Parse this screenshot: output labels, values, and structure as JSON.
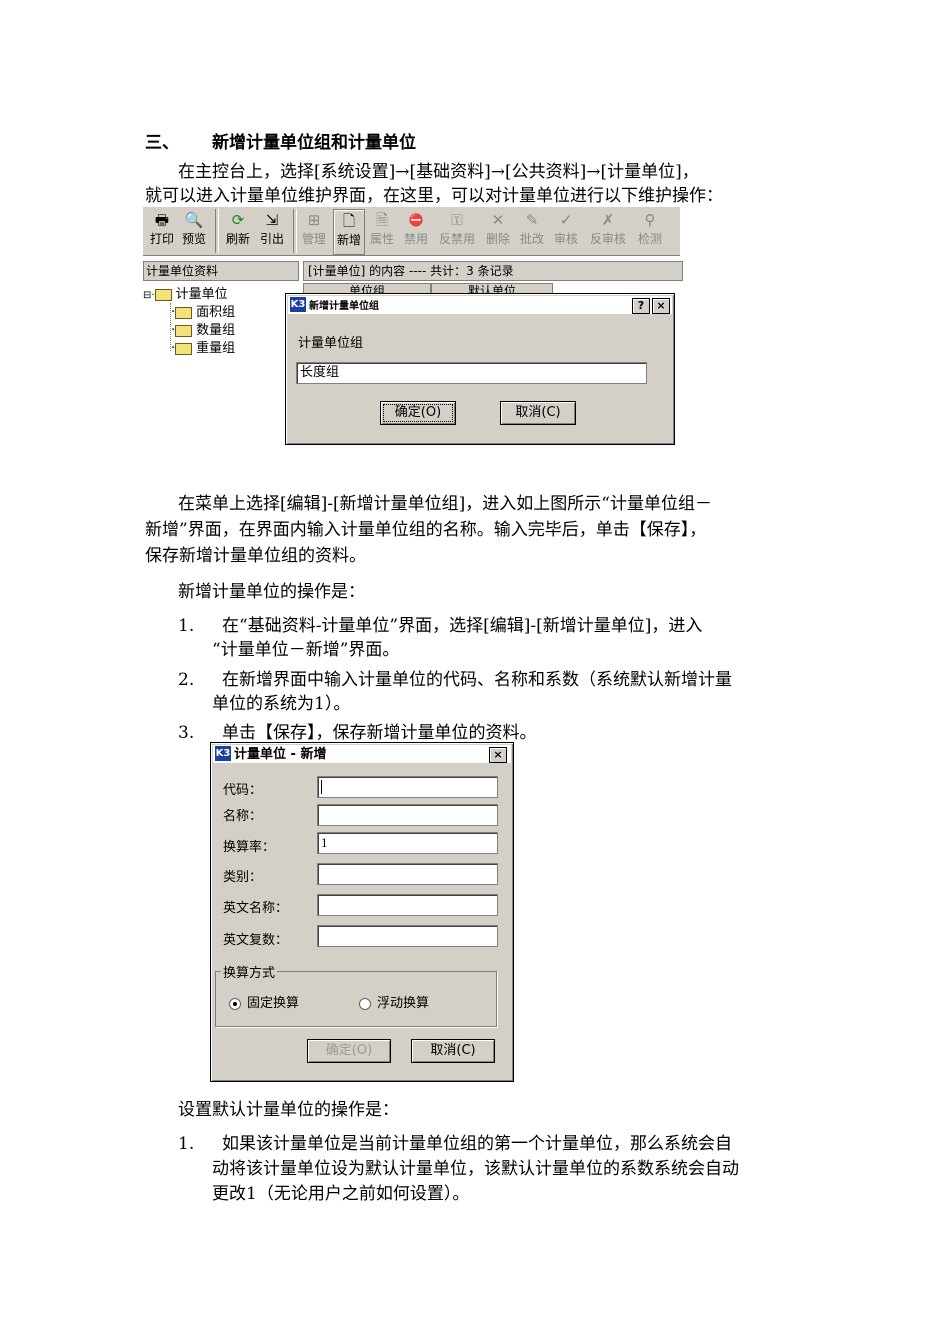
{
  "section": {
    "number": "三、",
    "title": "新增计量单位组和计量单位"
  },
  "intro": {
    "line1": "在主控台上，选择[系统设置]→[基础资料]→[公共资料]→[计量单位]，",
    "line2": "就可以进入计量单位维护界面，在这里，可以对计量单位进行以下维护操作："
  },
  "toolbar": {
    "buttons": [
      {
        "label": "打印",
        "icon": "printer-icon",
        "glyph": "🖶"
      },
      {
        "label": "预览",
        "icon": "preview-icon",
        "glyph": "🔍"
      },
      {
        "label": "刷新",
        "icon": "refresh-icon",
        "glyph": "⟳"
      },
      {
        "label": "引出",
        "icon": "export-icon",
        "glyph": "⇲"
      },
      {
        "label": "管理",
        "icon": "manage-icon",
        "glyph": "⊞"
      },
      {
        "label": "新增",
        "icon": "new-icon",
        "glyph": "🗋"
      },
      {
        "label": "属性",
        "icon": "properties-icon",
        "glyph": "🗎"
      },
      {
        "label": "禁用",
        "icon": "disable-icon",
        "glyph": "⛔"
      },
      {
        "label": "反禁用",
        "icon": "enable-icon",
        "glyph": "⚿"
      },
      {
        "label": "删除",
        "icon": "delete-icon",
        "glyph": "✕"
      },
      {
        "label": "批改",
        "icon": "batch-edit-icon",
        "glyph": "✎"
      },
      {
        "label": "审核",
        "icon": "approve-icon",
        "glyph": "✓"
      },
      {
        "label": "反审核",
        "icon": "unapprove-icon",
        "glyph": "✗"
      },
      {
        "label": "检测",
        "icon": "check-icon",
        "glyph": "⚲"
      }
    ]
  },
  "tree": {
    "header": "计量单位资料",
    "root": "计量单位",
    "children": [
      "面积组",
      "数量组",
      "重量组"
    ]
  },
  "list": {
    "header": "[计量单位] 的内容 ---- 共计：3 条记录",
    "columns": [
      "单位组",
      "默认单位"
    ]
  },
  "group_dialog": {
    "title": "新增计量单位组",
    "field_label": "计量单位组",
    "field_value": "长度组",
    "ok": "确定(O)",
    "cancel": "取消(C)",
    "help": "?",
    "close": "×"
  },
  "para1": {
    "line1": "在菜单上选择[编辑]-[新增计量单位组]，进入如上图所示“计量单位组－",
    "line2": "新增”界面，在界面内输入计量单位组的名称。输入完毕后，单击【保存】，",
    "line3": "保存新增计量单位组的资料。"
  },
  "para2": "新增计量单位的操作是：",
  "steps": [
    {
      "num": "1.",
      "line1": "在“基础资料-计量单位”界面，选择[编辑]-[新增计量单位]，进入",
      "line2": "“计量单位－新增”界面。"
    },
    {
      "num": "2.",
      "line1": "在新增界面中输入计量单位的代码、名称和系数（系统默认新增计量",
      "line2": "单位的系统为1）。"
    },
    {
      "num": "3.",
      "line1": "单击【保存】，保存新增计量单位的资料。",
      "line2": ""
    }
  ],
  "unit_dialog": {
    "title": "计量单位 - 新增",
    "close": "×",
    "fields": [
      {
        "label": "代码：",
        "value": ""
      },
      {
        "label": "名称：",
        "value": ""
      },
      {
        "label": "换算率：",
        "value": "1"
      },
      {
        "label": "类别：",
        "value": ""
      },
      {
        "label": "英文名称：",
        "value": ""
      },
      {
        "label": "英文复数：",
        "value": ""
      }
    ],
    "group_title": "换算方式",
    "radio_fixed": "固定换算",
    "radio_float": "浮动换算",
    "ok": "确定(O)",
    "cancel": "取消(C)"
  },
  "para3": "设置默认计量单位的操作是：",
  "default_steps": [
    {
      "num": "1.",
      "line1": "如果该计量单位是当前计量单位组的第一个计量单位，那么系统会自",
      "line2": "动将该计量单位设为默认计量单位，该默认计量单位的系数系统会自动",
      "line3": "更改1（无论用户之前如何设置）。"
    }
  ]
}
